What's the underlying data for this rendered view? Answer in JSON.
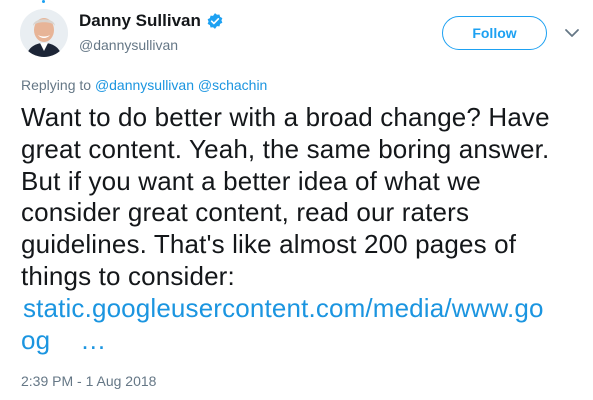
{
  "author": {
    "name": "Danny Sullivan",
    "handle": "@dannysullivan",
    "verified": true
  },
  "actions": {
    "follow_label": "Follow",
    "menu_icon": "chevron-down-icon"
  },
  "reply": {
    "prefix": "Replying to",
    "mention_1": "@dannysullivan",
    "mention_2": "@schachin"
  },
  "tweet": {
    "lines": [
      "Want to do better with a broad change? Have",
      "great content. Yeah, the same boring answer.",
      "But if you want a better idea of what we",
      "consider great content, read our raters",
      "guidelines. That's like almost 200 pages of",
      "things to consider:"
    ],
    "link_line_1": "static.googleusercontent.com/media/www.go",
    "link_line_2": "og",
    "link_ellipsis": "…"
  },
  "timestamp": "2:39 PM - 1 Aug 2018",
  "colors": {
    "accent": "#1da1f2",
    "link": "#1b95e0",
    "text": "#14171a",
    "muted": "#657786"
  }
}
